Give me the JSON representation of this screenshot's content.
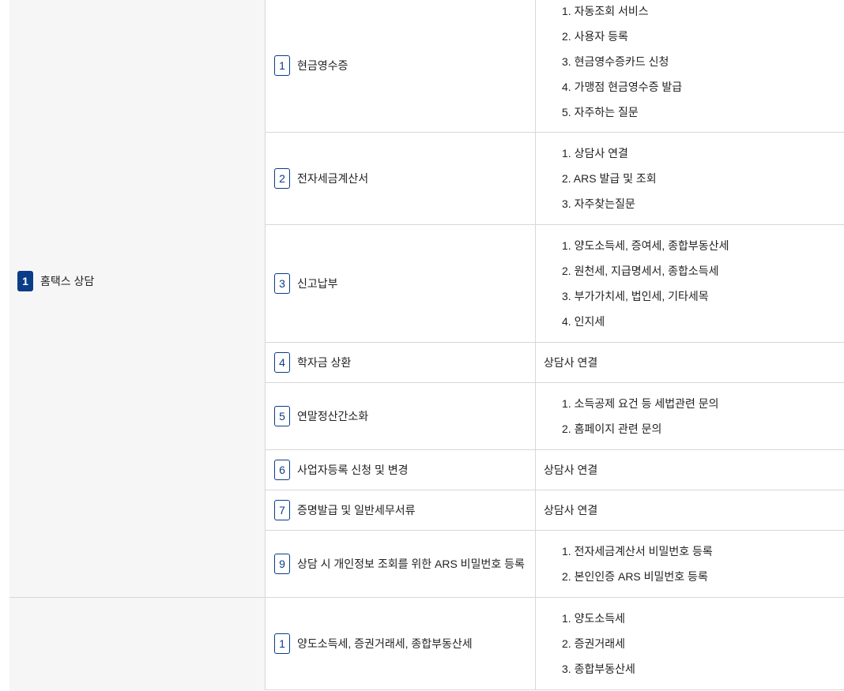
{
  "categories": [
    {
      "number": "1",
      "label": "홈택스 상담"
    },
    {
      "number": "",
      "label": ""
    }
  ],
  "rows": [
    {
      "number": "1",
      "label": "현금영수증",
      "items": [
        "1. 자동조회 서비스",
        "2. 사용자 등록",
        "3. 현금영수증카드 신청",
        "4. 가맹점 현금영수증 발급",
        "5. 자주하는 질문"
      ]
    },
    {
      "number": "2",
      "label": "전자세금계산서",
      "items": [
        "1. 상담사 연결",
        "2. ARS 발급 및 조회",
        "3. 자주찾는질문"
      ]
    },
    {
      "number": "3",
      "label": "신고납부",
      "items": [
        "1. 양도소득세, 증여세, 종합부동산세",
        "2. 원천세, 지급명세서, 종합소득세",
        "3. 부가가치세, 법인세, 기타세목",
        "4. 인지세"
      ]
    },
    {
      "number": "4",
      "label": "학자금 상환",
      "single": "상담사 연결"
    },
    {
      "number": "5",
      "label": "연말정산간소화",
      "items": [
        "1. 소득공제 요건 등 세법관련 문의",
        "2. 홈페이지 관련 문의"
      ]
    },
    {
      "number": "6",
      "label": "사업자등록 신청 및 변경",
      "single": "상담사 연결"
    },
    {
      "number": "7",
      "label": "증명발급 및 일반세무서류",
      "single": "상담사 연결"
    },
    {
      "number": "9",
      "label": "상담 시 개인정보 조회를 위한 ARS 비밀번호 등록",
      "items": [
        "1. 전자세금계산서 비밀번호 등록",
        "2. 본인인증 ARS 비밀번호 등록"
      ]
    },
    {
      "number": "1",
      "label": "양도소득세, 증권거래세, 종합부동산세",
      "items": [
        "1. 양도소득세",
        "2. 증권거래세",
        "3. 종합부동산세"
      ]
    }
  ],
  "colors": {
    "accent": "#0b3c88",
    "border": "#d7d7d7",
    "category_bg": "#f6f6f6"
  }
}
